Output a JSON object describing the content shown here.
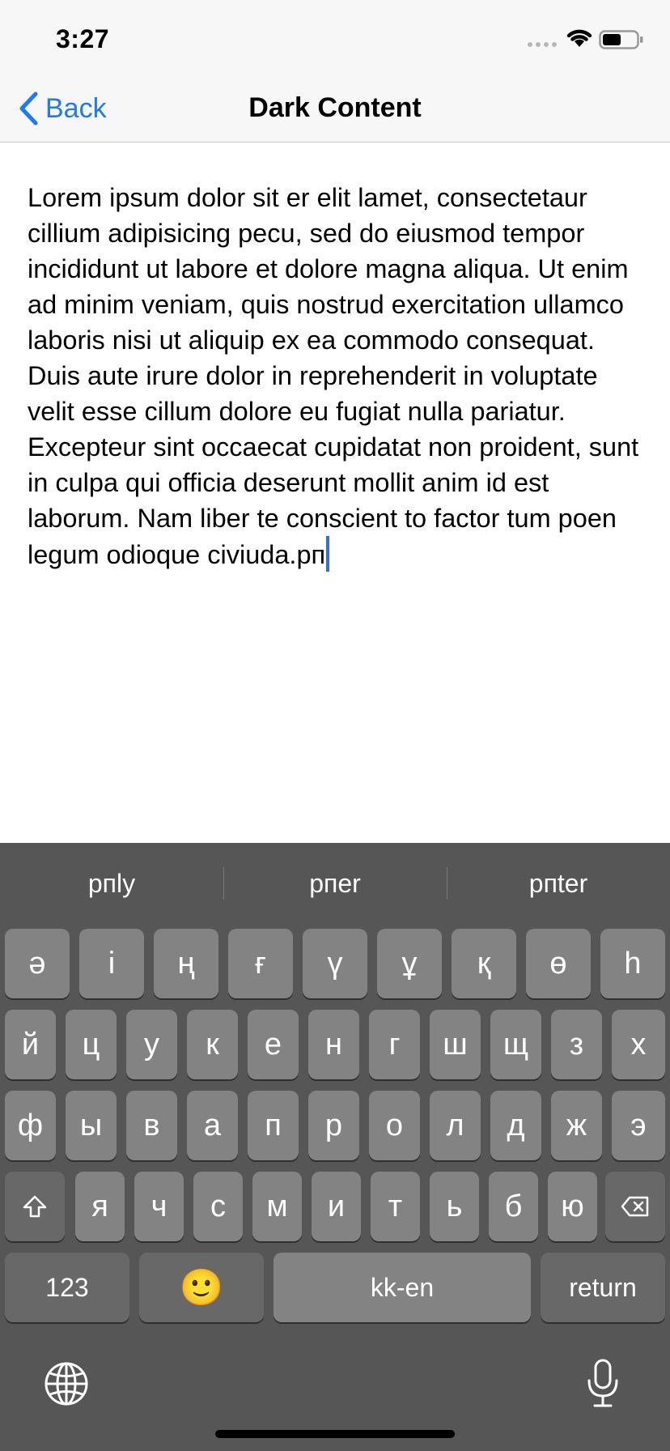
{
  "status_bar": {
    "time": "3:27"
  },
  "nav": {
    "back_label": "Back",
    "title": "Dark Content"
  },
  "text_view": {
    "content": "Lorem ipsum dolor sit er elit lamet, consectetaur cillium adipisicing pecu, sed do eiusmod tempor incididunt ut labore et dolore magna aliqua. Ut enim ad minim veniam, quis nostrud exercitation ullamco laboris nisi ut aliquip ex ea commodo consequat. Duis aute irure dolor in reprehenderit in voluptate velit esse cillum dolore eu fugiat nulla pariatur. Excepteur sint occaecat cupidatat non proident, sunt in culpa qui officia deserunt mollit anim id est laborum. Nam liber te conscient to factor tum poen legum odioque civiuda.рп"
  },
  "keyboard": {
    "suggestions": [
      "рпly",
      "рпer",
      "рпter"
    ],
    "row1": [
      "ә",
      "і",
      "ң",
      "ғ",
      "ү",
      "ұ",
      "қ",
      "ө",
      "һ"
    ],
    "row2": [
      "й",
      "ц",
      "у",
      "к",
      "е",
      "н",
      "г",
      "ш",
      "щ",
      "з",
      "х"
    ],
    "row3": [
      "ф",
      "ы",
      "в",
      "а",
      "п",
      "р",
      "о",
      "л",
      "д",
      "ж",
      "э"
    ],
    "row4": [
      "я",
      "ч",
      "с",
      "м",
      "и",
      "т",
      "ь",
      "б",
      "ю"
    ],
    "numbers_label": "123",
    "emoji_label": "🙂",
    "space_label": "kk-en",
    "return_label": "return",
    "icons": [
      "shift-icon",
      "delete-icon",
      "globe-icon",
      "microphone-icon",
      "wifi-icon",
      "battery-icon",
      "back-chevron-icon"
    ]
  },
  "colors": {
    "accent": "#1e7bf0",
    "caret": "#2f6cf0",
    "keyboard_bg": "#565656",
    "key_bg": "#838383",
    "func_key_bg": "#686868"
  }
}
